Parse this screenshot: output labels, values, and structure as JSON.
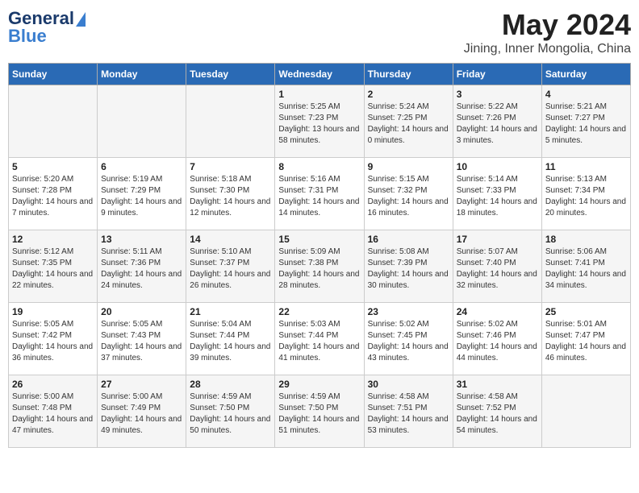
{
  "logo": {
    "general": "General",
    "blue": "Blue"
  },
  "title": "May 2024",
  "location": "Jining, Inner Mongolia, China",
  "days_of_week": [
    "Sunday",
    "Monday",
    "Tuesday",
    "Wednesday",
    "Thursday",
    "Friday",
    "Saturday"
  ],
  "weeks": [
    [
      {
        "day": "",
        "info": ""
      },
      {
        "day": "",
        "info": ""
      },
      {
        "day": "",
        "info": ""
      },
      {
        "day": "1",
        "info": "Sunrise: 5:25 AM\nSunset: 7:23 PM\nDaylight: 13 hours and 58 minutes."
      },
      {
        "day": "2",
        "info": "Sunrise: 5:24 AM\nSunset: 7:25 PM\nDaylight: 14 hours and 0 minutes."
      },
      {
        "day": "3",
        "info": "Sunrise: 5:22 AM\nSunset: 7:26 PM\nDaylight: 14 hours and 3 minutes."
      },
      {
        "day": "4",
        "info": "Sunrise: 5:21 AM\nSunset: 7:27 PM\nDaylight: 14 hours and 5 minutes."
      }
    ],
    [
      {
        "day": "5",
        "info": "Sunrise: 5:20 AM\nSunset: 7:28 PM\nDaylight: 14 hours and 7 minutes."
      },
      {
        "day": "6",
        "info": "Sunrise: 5:19 AM\nSunset: 7:29 PM\nDaylight: 14 hours and 9 minutes."
      },
      {
        "day": "7",
        "info": "Sunrise: 5:18 AM\nSunset: 7:30 PM\nDaylight: 14 hours and 12 minutes."
      },
      {
        "day": "8",
        "info": "Sunrise: 5:16 AM\nSunset: 7:31 PM\nDaylight: 14 hours and 14 minutes."
      },
      {
        "day": "9",
        "info": "Sunrise: 5:15 AM\nSunset: 7:32 PM\nDaylight: 14 hours and 16 minutes."
      },
      {
        "day": "10",
        "info": "Sunrise: 5:14 AM\nSunset: 7:33 PM\nDaylight: 14 hours and 18 minutes."
      },
      {
        "day": "11",
        "info": "Sunrise: 5:13 AM\nSunset: 7:34 PM\nDaylight: 14 hours and 20 minutes."
      }
    ],
    [
      {
        "day": "12",
        "info": "Sunrise: 5:12 AM\nSunset: 7:35 PM\nDaylight: 14 hours and 22 minutes."
      },
      {
        "day": "13",
        "info": "Sunrise: 5:11 AM\nSunset: 7:36 PM\nDaylight: 14 hours and 24 minutes."
      },
      {
        "day": "14",
        "info": "Sunrise: 5:10 AM\nSunset: 7:37 PM\nDaylight: 14 hours and 26 minutes."
      },
      {
        "day": "15",
        "info": "Sunrise: 5:09 AM\nSunset: 7:38 PM\nDaylight: 14 hours and 28 minutes."
      },
      {
        "day": "16",
        "info": "Sunrise: 5:08 AM\nSunset: 7:39 PM\nDaylight: 14 hours and 30 minutes."
      },
      {
        "day": "17",
        "info": "Sunrise: 5:07 AM\nSunset: 7:40 PM\nDaylight: 14 hours and 32 minutes."
      },
      {
        "day": "18",
        "info": "Sunrise: 5:06 AM\nSunset: 7:41 PM\nDaylight: 14 hours and 34 minutes."
      }
    ],
    [
      {
        "day": "19",
        "info": "Sunrise: 5:05 AM\nSunset: 7:42 PM\nDaylight: 14 hours and 36 minutes."
      },
      {
        "day": "20",
        "info": "Sunrise: 5:05 AM\nSunset: 7:43 PM\nDaylight: 14 hours and 37 minutes."
      },
      {
        "day": "21",
        "info": "Sunrise: 5:04 AM\nSunset: 7:44 PM\nDaylight: 14 hours and 39 minutes."
      },
      {
        "day": "22",
        "info": "Sunrise: 5:03 AM\nSunset: 7:44 PM\nDaylight: 14 hours and 41 minutes."
      },
      {
        "day": "23",
        "info": "Sunrise: 5:02 AM\nSunset: 7:45 PM\nDaylight: 14 hours and 43 minutes."
      },
      {
        "day": "24",
        "info": "Sunrise: 5:02 AM\nSunset: 7:46 PM\nDaylight: 14 hours and 44 minutes."
      },
      {
        "day": "25",
        "info": "Sunrise: 5:01 AM\nSunset: 7:47 PM\nDaylight: 14 hours and 46 minutes."
      }
    ],
    [
      {
        "day": "26",
        "info": "Sunrise: 5:00 AM\nSunset: 7:48 PM\nDaylight: 14 hours and 47 minutes."
      },
      {
        "day": "27",
        "info": "Sunrise: 5:00 AM\nSunset: 7:49 PM\nDaylight: 14 hours and 49 minutes."
      },
      {
        "day": "28",
        "info": "Sunrise: 4:59 AM\nSunset: 7:50 PM\nDaylight: 14 hours and 50 minutes."
      },
      {
        "day": "29",
        "info": "Sunrise: 4:59 AM\nSunset: 7:50 PM\nDaylight: 14 hours and 51 minutes."
      },
      {
        "day": "30",
        "info": "Sunrise: 4:58 AM\nSunset: 7:51 PM\nDaylight: 14 hours and 53 minutes."
      },
      {
        "day": "31",
        "info": "Sunrise: 4:58 AM\nSunset: 7:52 PM\nDaylight: 14 hours and 54 minutes."
      },
      {
        "day": "",
        "info": ""
      }
    ]
  ]
}
